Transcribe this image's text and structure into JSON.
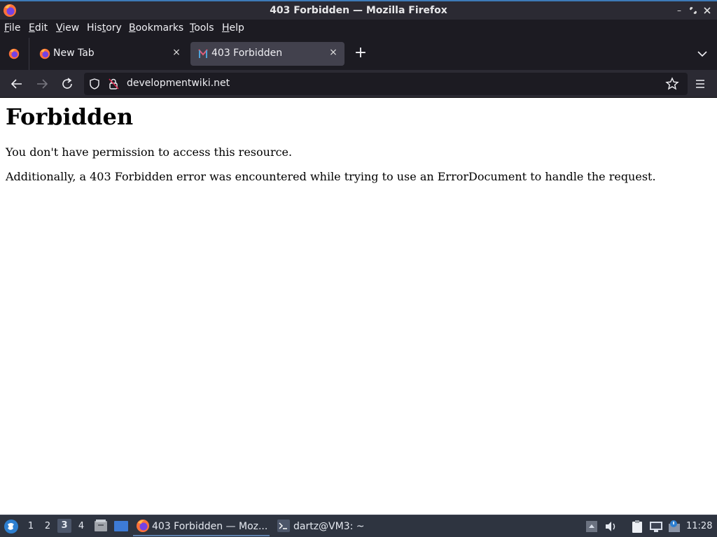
{
  "window": {
    "title": "403 Forbidden — Mozilla Firefox"
  },
  "menubar": {
    "items": [
      {
        "label_first": "F",
        "label_rest": "ile"
      },
      {
        "label_first": "E",
        "label_rest": "dit"
      },
      {
        "label_first": "V",
        "label_rest": "iew"
      },
      {
        "label_first": "His",
        "label_underline": "t",
        "label_rest": "ory"
      },
      {
        "label_first": "B",
        "label_rest": "ookmarks"
      },
      {
        "label_first": "T",
        "label_rest": "ools"
      },
      {
        "label_first": "H",
        "label_rest": "elp"
      }
    ]
  },
  "tabs": [
    {
      "label": "New Tab",
      "close": "×",
      "active": false
    },
    {
      "label": "403 Forbidden",
      "close": "×",
      "active": true
    }
  ],
  "newtab": {
    "label": "+"
  },
  "navbar": {
    "url": "developmentwiki.net"
  },
  "page": {
    "heading": "Forbidden",
    "para1": "You don't have permission to access this resource.",
    "para2": "Additionally, a 403 Forbidden error was encountered while trying to use an ErrorDocument to handle the request."
  },
  "taskbar": {
    "workspaces": [
      "1",
      "2",
      "3",
      "4"
    ],
    "active_workspace": "3",
    "tasks": [
      {
        "label": "403 Forbidden — Moz...",
        "icon": "firefox-icon"
      },
      {
        "label": "dartz@VM3: ~",
        "icon": "terminal-icon"
      }
    ],
    "clock": "11:28"
  },
  "colors": {
    "accent": "#3d7ab8",
    "tab_active": "#42414d",
    "taskbar": "#2e3440"
  }
}
